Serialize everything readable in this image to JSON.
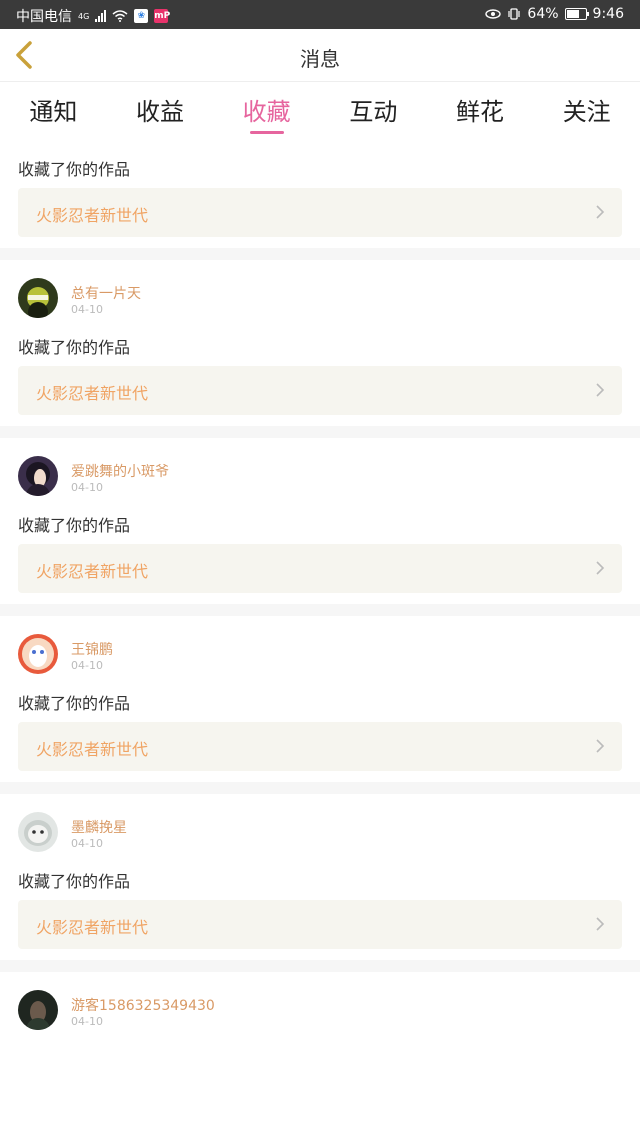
{
  "status_bar": {
    "carrier": "中国电信",
    "network": "4G",
    "app_badge": "mP",
    "battery_percent": "64%",
    "battery_level": 0.64,
    "time": "9:46"
  },
  "header": {
    "title": "消息",
    "back_icon": "chevron-left-icon",
    "accent_color": "#c9a13a"
  },
  "tabs": [
    {
      "label": "通知",
      "active": false
    },
    {
      "label": "收益",
      "active": false
    },
    {
      "label": "收藏",
      "active": true
    },
    {
      "label": "互动",
      "active": false
    },
    {
      "label": "鲜花",
      "active": false
    },
    {
      "label": "关注",
      "active": false
    }
  ],
  "colors": {
    "active_tab": "#e6659e",
    "username": "#d99a66",
    "work_title": "#f0a464",
    "work_row_bg": "#f6f5ef"
  },
  "notifications": [
    {
      "action": "收藏了你的作品",
      "work_title": "火影忍者新世代"
    },
    {
      "username": "总有一片天",
      "date": "04-10",
      "action": "收藏了你的作品",
      "work_title": "火影忍者新世代"
    },
    {
      "username": "爱跳舞的小斑爷",
      "date": "04-10",
      "action": "收藏了你的作品",
      "work_title": "火影忍者新世代"
    },
    {
      "username": "王锦鹏",
      "date": "04-10",
      "action": "收藏了你的作品",
      "work_title": "火影忍者新世代"
    },
    {
      "username": "墨麟挽星",
      "date": "04-10",
      "action": "收藏了你的作品",
      "work_title": "火影忍者新世代"
    },
    {
      "username": "游客1586325349430",
      "date": "04-10"
    }
  ]
}
